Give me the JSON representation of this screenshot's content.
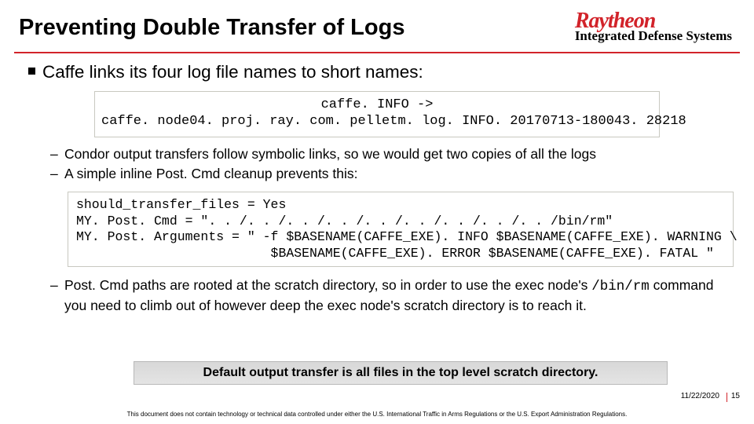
{
  "header": {
    "title": "Preventing Double Transfer of Logs",
    "logo_brand": "Raytheon",
    "logo_sub": "Integrated Defense Systems"
  },
  "bullet1": "Caffe links its four log file names to short names:",
  "symlink_box": {
    "line1": "caffe. INFO ->",
    "line2": "caffe. node04. proj. ray. com. pelletm. log. INFO. 20170713-180043. 28218"
  },
  "sub1": "Condor output transfers follow symbolic links, so we would get two copies of all the logs",
  "sub2": "A simple inline Post. Cmd cleanup prevents this:",
  "codebox": {
    "l1": "should_transfer_files = Yes",
    "l2": "MY. Post. Cmd = \". . /. . /. . /. . /. . /. . /. . /. . /. . /bin/rm\"",
    "l3": "MY. Post. Arguments = \" -f $BASENAME(CAFFE_EXE). INFO $BASENAME(CAFFE_EXE). WARNING \\",
    "l4": "                         $BASENAME(CAFFE_EXE). ERROR $BASENAME(CAFFE_EXE). FATAL \""
  },
  "sub3_a": "Post. Cmd paths are rooted at the scratch directory, so in order to use the exec node's ",
  "sub3_mono": "/bin/rm",
  "sub3_b": " command you need to climb out of however deep the exec node's scratch directory is to reach it.",
  "lesson": "Default output transfer is all files in the top level scratch directory.",
  "footer": {
    "date": "11/22/2020",
    "page": "15",
    "disclaimer": "This document does not contain technology or technical data controlled under either the U.S. International Traffic in Arms Regulations or the U.S. Export Administration Regulations."
  }
}
